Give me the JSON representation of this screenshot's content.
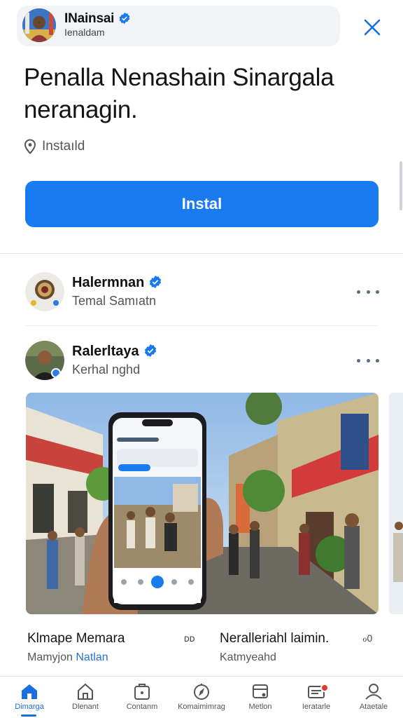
{
  "header": {
    "name": "INainsai",
    "subtitle": "Ienaldam"
  },
  "headline": "Penalla Nenashain Sinargala neranagin.",
  "location": "Instaıld",
  "install_label": "Instal",
  "accounts": [
    {
      "name": "Halermnan",
      "subtitle": "Temal Samıatn"
    },
    {
      "name": "Ralerltaya",
      "subtitle": "Kerhal nghd"
    }
  ],
  "cards": [
    {
      "title": "Klmape Memara",
      "sub_plain": "Mamyjon ",
      "sub_accent": "Natlan",
      "meta": "ᴅᴅ"
    },
    {
      "title": "Neralleriahl laimin.",
      "sub_plain": "Katmyeahd",
      "sub_accent": "",
      "meta": "ℴ0"
    }
  ],
  "nav": [
    {
      "label": "Dimarga",
      "icon": "home-icon",
      "active": true
    },
    {
      "label": "Dlenant",
      "icon": "store-icon",
      "active": false
    },
    {
      "label": "Contanm",
      "icon": "briefcase-icon",
      "active": false
    },
    {
      "label": "Komaimimrag",
      "icon": "compass-icon",
      "active": false
    },
    {
      "label": "Metlon",
      "icon": "media-icon",
      "active": false
    },
    {
      "label": "Ieratarle",
      "icon": "inbox-icon",
      "active": false,
      "badge": true
    },
    {
      "label": "Ataetale",
      "icon": "profile-icon",
      "active": false
    }
  ],
  "colors": {
    "accent": "#1a7bf1",
    "verified": "#1877f2",
    "badge": "#e03a2f"
  }
}
